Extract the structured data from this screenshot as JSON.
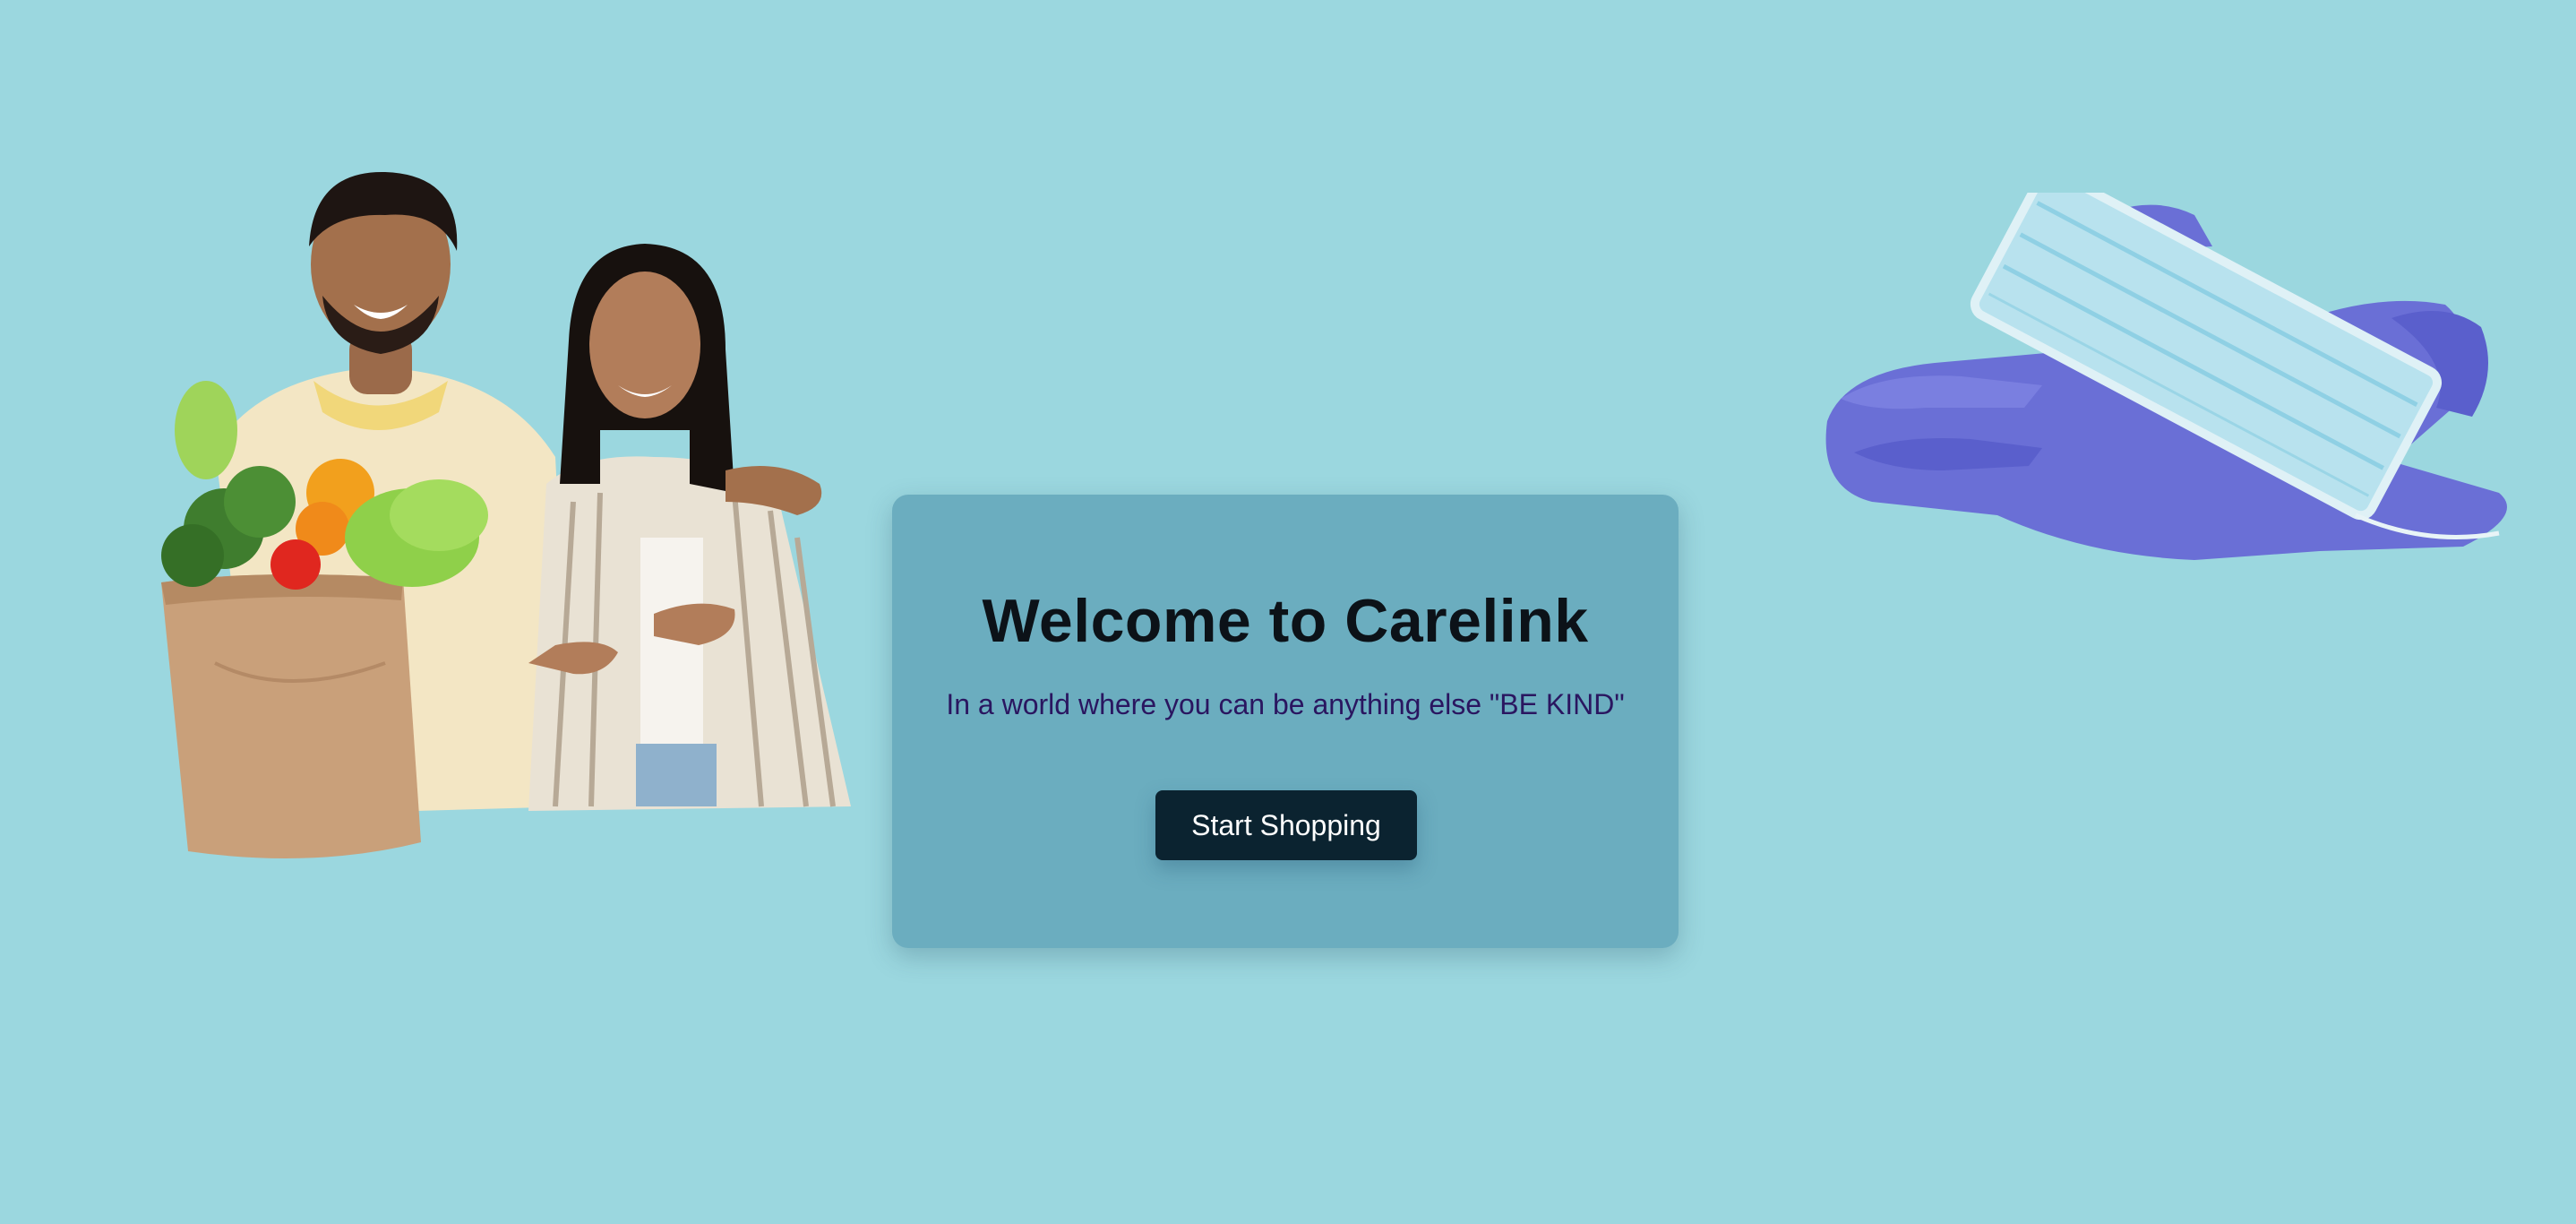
{
  "hero": {
    "title": "Welcome to Carelink",
    "subtitle": "In a world where you can be anything else \"BE KIND\"",
    "cta_label": "Start Shopping"
  },
  "images": {
    "left": "couple-with-grocery-bag",
    "right": "gloves-and-face-mask"
  },
  "colors": {
    "background": "#9bd7df",
    "card": "#6badbf",
    "button": "#0b2330",
    "title": "#0c1218",
    "subtitle": "#2a1660"
  }
}
